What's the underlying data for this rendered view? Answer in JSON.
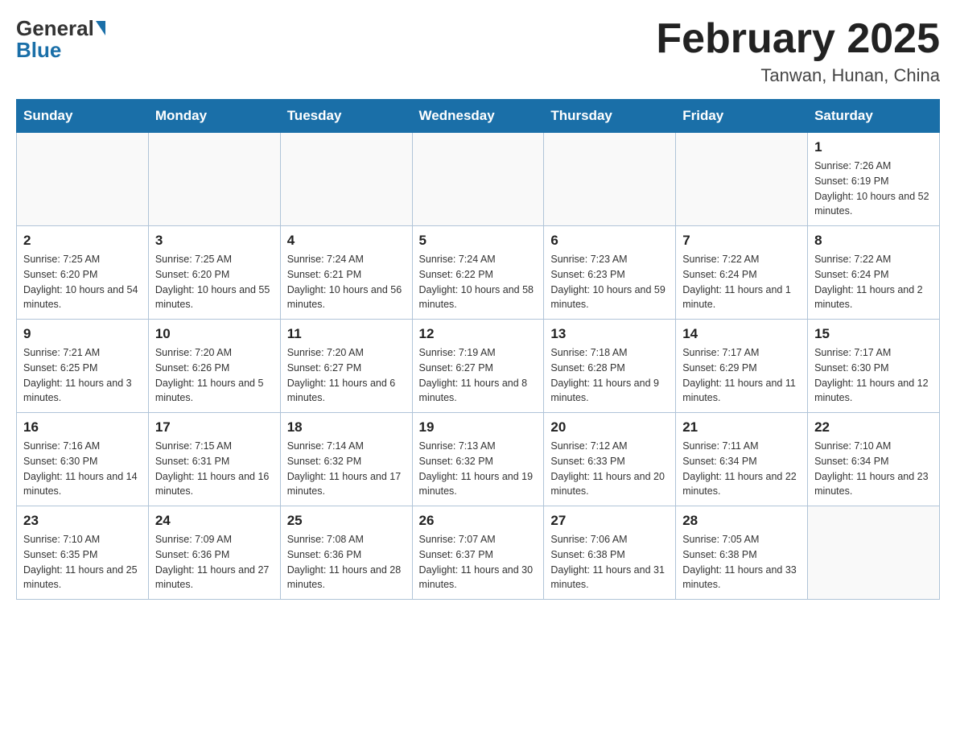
{
  "logo": {
    "general": "General",
    "blue": "Blue"
  },
  "title": "February 2025",
  "location": "Tanwan, Hunan, China",
  "days_of_week": [
    "Sunday",
    "Monday",
    "Tuesday",
    "Wednesday",
    "Thursday",
    "Friday",
    "Saturday"
  ],
  "weeks": [
    [
      {
        "day": "",
        "info": ""
      },
      {
        "day": "",
        "info": ""
      },
      {
        "day": "",
        "info": ""
      },
      {
        "day": "",
        "info": ""
      },
      {
        "day": "",
        "info": ""
      },
      {
        "day": "",
        "info": ""
      },
      {
        "day": "1",
        "info": "Sunrise: 7:26 AM\nSunset: 6:19 PM\nDaylight: 10 hours and 52 minutes."
      }
    ],
    [
      {
        "day": "2",
        "info": "Sunrise: 7:25 AM\nSunset: 6:20 PM\nDaylight: 10 hours and 54 minutes."
      },
      {
        "day": "3",
        "info": "Sunrise: 7:25 AM\nSunset: 6:20 PM\nDaylight: 10 hours and 55 minutes."
      },
      {
        "day": "4",
        "info": "Sunrise: 7:24 AM\nSunset: 6:21 PM\nDaylight: 10 hours and 56 minutes."
      },
      {
        "day": "5",
        "info": "Sunrise: 7:24 AM\nSunset: 6:22 PM\nDaylight: 10 hours and 58 minutes."
      },
      {
        "day": "6",
        "info": "Sunrise: 7:23 AM\nSunset: 6:23 PM\nDaylight: 10 hours and 59 minutes."
      },
      {
        "day": "7",
        "info": "Sunrise: 7:22 AM\nSunset: 6:24 PM\nDaylight: 11 hours and 1 minute."
      },
      {
        "day": "8",
        "info": "Sunrise: 7:22 AM\nSunset: 6:24 PM\nDaylight: 11 hours and 2 minutes."
      }
    ],
    [
      {
        "day": "9",
        "info": "Sunrise: 7:21 AM\nSunset: 6:25 PM\nDaylight: 11 hours and 3 minutes."
      },
      {
        "day": "10",
        "info": "Sunrise: 7:20 AM\nSunset: 6:26 PM\nDaylight: 11 hours and 5 minutes."
      },
      {
        "day": "11",
        "info": "Sunrise: 7:20 AM\nSunset: 6:27 PM\nDaylight: 11 hours and 6 minutes."
      },
      {
        "day": "12",
        "info": "Sunrise: 7:19 AM\nSunset: 6:27 PM\nDaylight: 11 hours and 8 minutes."
      },
      {
        "day": "13",
        "info": "Sunrise: 7:18 AM\nSunset: 6:28 PM\nDaylight: 11 hours and 9 minutes."
      },
      {
        "day": "14",
        "info": "Sunrise: 7:17 AM\nSunset: 6:29 PM\nDaylight: 11 hours and 11 minutes."
      },
      {
        "day": "15",
        "info": "Sunrise: 7:17 AM\nSunset: 6:30 PM\nDaylight: 11 hours and 12 minutes."
      }
    ],
    [
      {
        "day": "16",
        "info": "Sunrise: 7:16 AM\nSunset: 6:30 PM\nDaylight: 11 hours and 14 minutes."
      },
      {
        "day": "17",
        "info": "Sunrise: 7:15 AM\nSunset: 6:31 PM\nDaylight: 11 hours and 16 minutes."
      },
      {
        "day": "18",
        "info": "Sunrise: 7:14 AM\nSunset: 6:32 PM\nDaylight: 11 hours and 17 minutes."
      },
      {
        "day": "19",
        "info": "Sunrise: 7:13 AM\nSunset: 6:32 PM\nDaylight: 11 hours and 19 minutes."
      },
      {
        "day": "20",
        "info": "Sunrise: 7:12 AM\nSunset: 6:33 PM\nDaylight: 11 hours and 20 minutes."
      },
      {
        "day": "21",
        "info": "Sunrise: 7:11 AM\nSunset: 6:34 PM\nDaylight: 11 hours and 22 minutes."
      },
      {
        "day": "22",
        "info": "Sunrise: 7:10 AM\nSunset: 6:34 PM\nDaylight: 11 hours and 23 minutes."
      }
    ],
    [
      {
        "day": "23",
        "info": "Sunrise: 7:10 AM\nSunset: 6:35 PM\nDaylight: 11 hours and 25 minutes."
      },
      {
        "day": "24",
        "info": "Sunrise: 7:09 AM\nSunset: 6:36 PM\nDaylight: 11 hours and 27 minutes."
      },
      {
        "day": "25",
        "info": "Sunrise: 7:08 AM\nSunset: 6:36 PM\nDaylight: 11 hours and 28 minutes."
      },
      {
        "day": "26",
        "info": "Sunrise: 7:07 AM\nSunset: 6:37 PM\nDaylight: 11 hours and 30 minutes."
      },
      {
        "day": "27",
        "info": "Sunrise: 7:06 AM\nSunset: 6:38 PM\nDaylight: 11 hours and 31 minutes."
      },
      {
        "day": "28",
        "info": "Sunrise: 7:05 AM\nSunset: 6:38 PM\nDaylight: 11 hours and 33 minutes."
      },
      {
        "day": "",
        "info": ""
      }
    ]
  ]
}
